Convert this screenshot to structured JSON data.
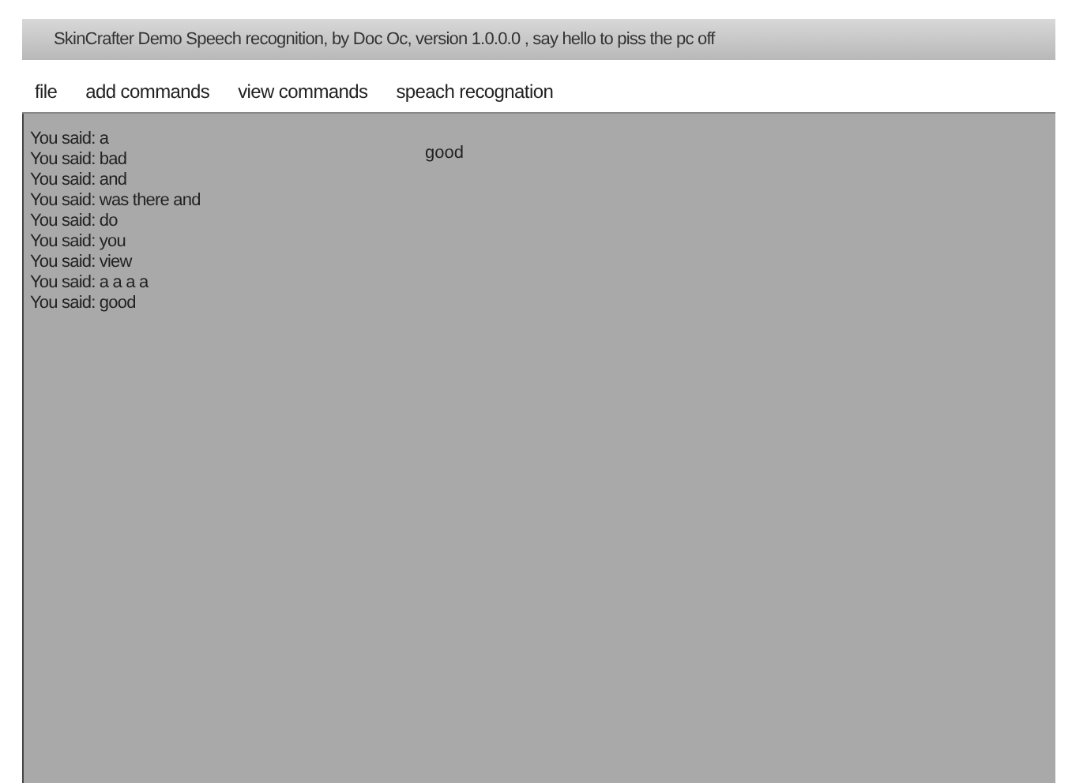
{
  "window": {
    "title": "SkinCrafter Demo Speech recognition, by Doc Oc, version 1.0.0.0 , say hello to piss the pc off"
  },
  "menu": [
    "file",
    "add commands",
    "view commands",
    "speach recognation"
  ],
  "log": [
    "You said: a",
    "You said: bad",
    "You said: and",
    "You said: was there and",
    "You said: do",
    "You said: you",
    "You said: view",
    "You said: a a a a",
    "You said: good"
  ],
  "result": "good"
}
